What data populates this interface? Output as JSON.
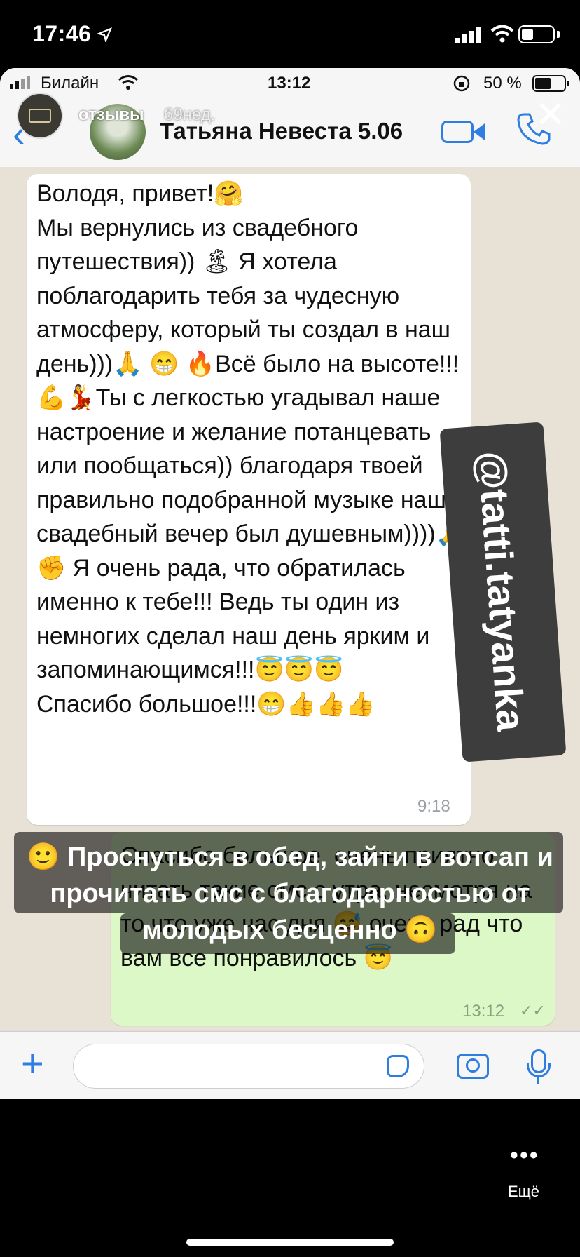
{
  "outer_status": {
    "time": "17:46"
  },
  "whatsapp": {
    "status": {
      "carrier": "Билайн",
      "time": "13:12",
      "battery": "50 %"
    },
    "contact_name": "Татьяна Невеста 5.06",
    "incoming": {
      "text": "Володя, привет!🤗\nМы вернулись из свадебного путешествия)) 🏝 Я хотела поблагодарить тебя за чудесную атмосферу, который ты создал в наш день)))🙏 😁 🔥Всё было на высоте!!!💪💃Ты с легкостью угадывал наше настроение и желание потанцевать или пообщаться)) благодаря твоей правильно подобранной музыке наш свадебный вечер был душевным))))🙏 ✊ Я очень рада, что обратилась именно к тебе!!! Ведь ты один из немногих сделал наш день ярким и запоминающимся!!!😇😇😇\nСпасибо большое!!!😁👍👍👍",
      "time": "9:18"
    },
    "outgoing": {
      "text": "Спасибо большое, очень приятно читать такие смс с утра, несмотря на то что уже час дня 😅 очень рад что вам все понравилось 😇",
      "time": "13:12",
      "ticks": "✓✓"
    },
    "input": {
      "placeholder": ""
    }
  },
  "story": {
    "username": "отзывы",
    "age": "69нед.",
    "handle_sticker": "@tatti.tatyanka",
    "caption": "🙂 Проснуться в обед, зайти в вотсап и прочитать смс с благодарностью от молодых бесценно 🙃",
    "more_label": "Ещё"
  },
  "colors": {
    "whatsapp_blue": "#2e7de1",
    "outgoing_bubble": "#dcf8c6"
  }
}
